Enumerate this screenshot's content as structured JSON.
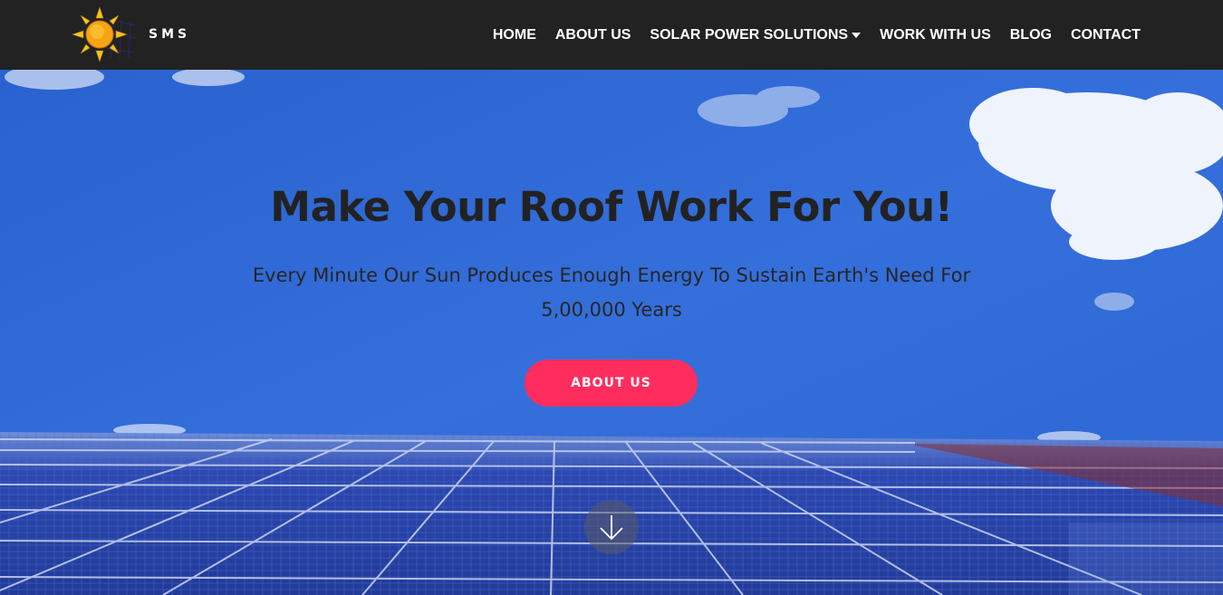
{
  "brand": {
    "name": "SMS",
    "logo": "sun-over-solar-panel-logo"
  },
  "nav": {
    "items": [
      {
        "label": "HOME"
      },
      {
        "label": "ABOUT US"
      },
      {
        "label": "SOLAR POWER SOLUTIONS",
        "dropdown": true
      },
      {
        "label": "WORK WITH US"
      },
      {
        "label": "BLOG"
      },
      {
        "label": "CONTACT"
      }
    ]
  },
  "hero": {
    "headline": "Make Your Roof Work For You!",
    "subline": "Every Minute Our Sun Produces Enough Energy To Sustain Earth's Need For 5,00,000 Years",
    "cta_label": "ABOUT US",
    "scroll_icon": "arrow-down-icon",
    "background": "blue-sky-with-solar-panels"
  },
  "colors": {
    "navbar": "#222222",
    "accent": "#ff2d5e",
    "sky": "#2f6fd8",
    "headline": "#222222"
  }
}
